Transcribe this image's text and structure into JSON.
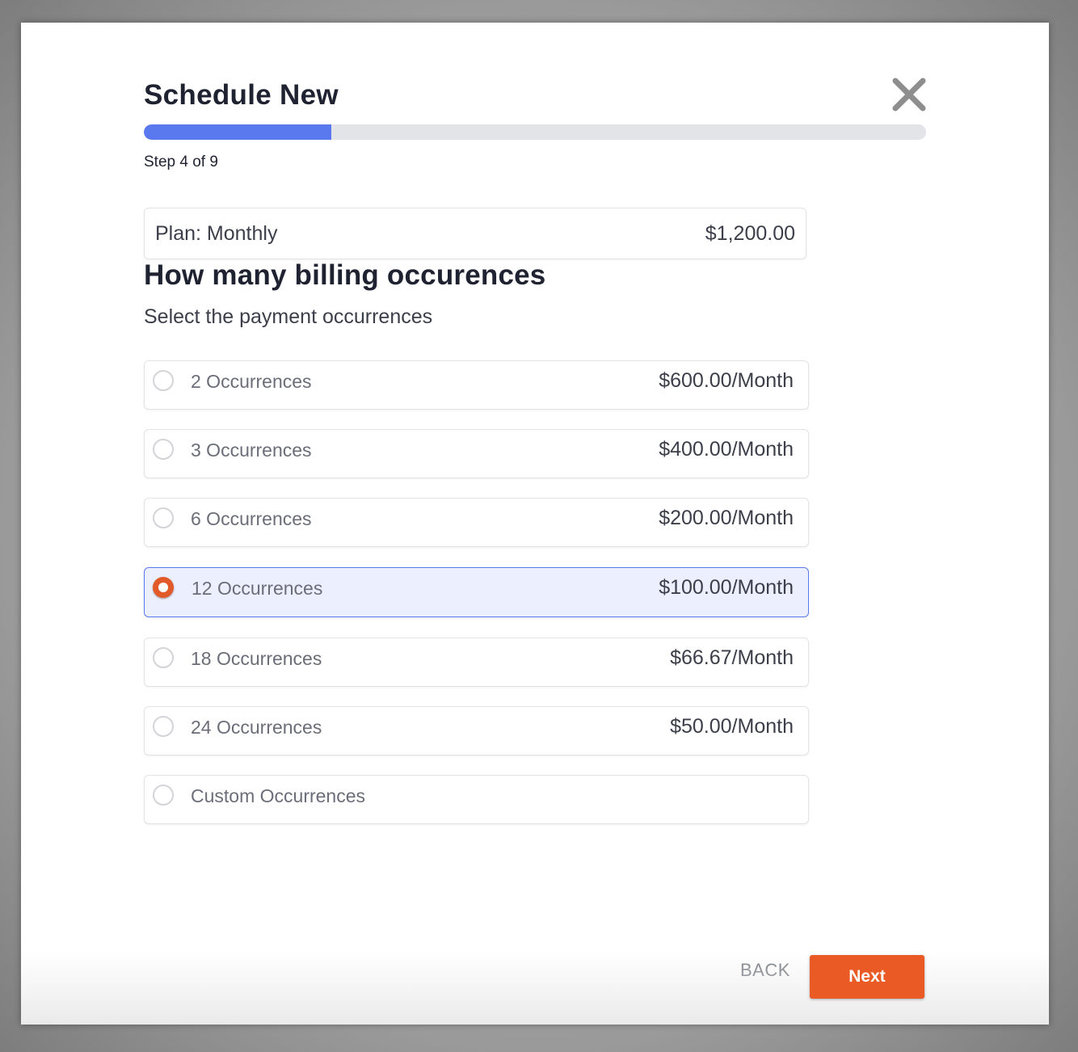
{
  "modal": {
    "title": "Schedule New",
    "close_icon": "close-icon",
    "progress": {
      "current_step": 4,
      "total_steps": 9,
      "fraction": 0.24
    },
    "step_text": "Step 4 of 9"
  },
  "plan": {
    "label": "Plan: Monthly",
    "amount": "$1,200.00"
  },
  "question": {
    "heading": "How many billing occurences",
    "subtext": "Select the payment occurrences"
  },
  "options": [
    {
      "label": "2 Occurrences",
      "price": "$600.00/Month",
      "selected": false
    },
    {
      "label": "3 Occurrences",
      "price": "$400.00/Month",
      "selected": false
    },
    {
      "label": "6 Occurrences",
      "price": "$200.00/Month",
      "selected": false
    },
    {
      "label": "12 Occurrences",
      "price": "$100.00/Month",
      "selected": true
    },
    {
      "label": "18 Occurrences",
      "price": "$66.67/Month",
      "selected": false
    },
    {
      "label": "24 Occurrences",
      "price": "$50.00/Month",
      "selected": false
    },
    {
      "label": "Custom Occurrences",
      "price": "",
      "selected": false
    }
  ],
  "footer": {
    "back_label": "BACK",
    "next_label": "Next"
  },
  "colors": {
    "accent_blue": "#5b79ee",
    "accent_orange": "#ea5a25",
    "selected_bg": "#eceffd"
  }
}
